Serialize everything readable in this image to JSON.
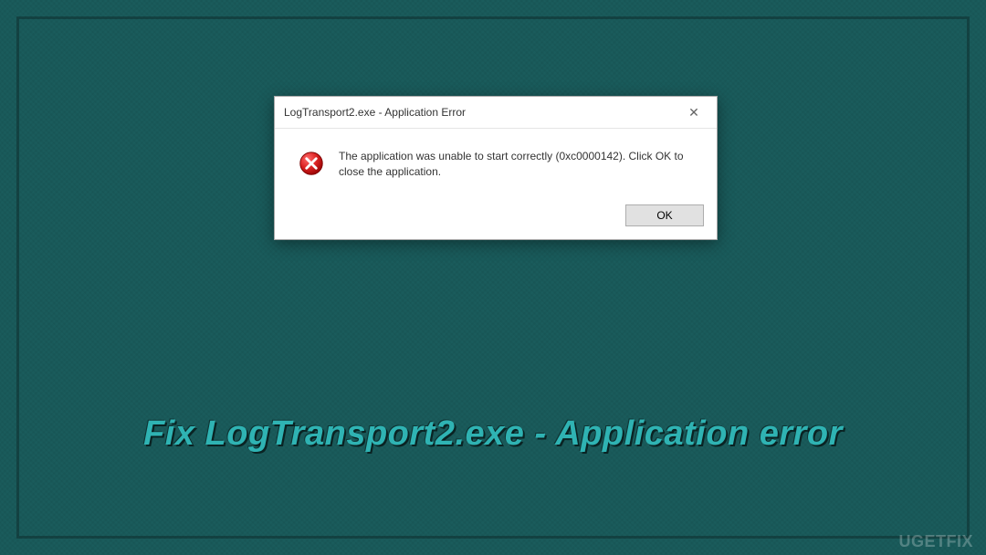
{
  "dialog": {
    "title": "LogTransport2.exe - Application Error",
    "close_label": "✕",
    "message": "The application was unable to start correctly (0xc0000142). Click OK to close the application.",
    "ok_label": "OK"
  },
  "caption": "Fix LogTransport2.exe - Application error",
  "watermark": "UGETFIX",
  "icons": {
    "error": "error-icon",
    "close": "close-icon"
  },
  "colors": {
    "background": "#1a5c5c",
    "caption": "#2fb3b3"
  }
}
